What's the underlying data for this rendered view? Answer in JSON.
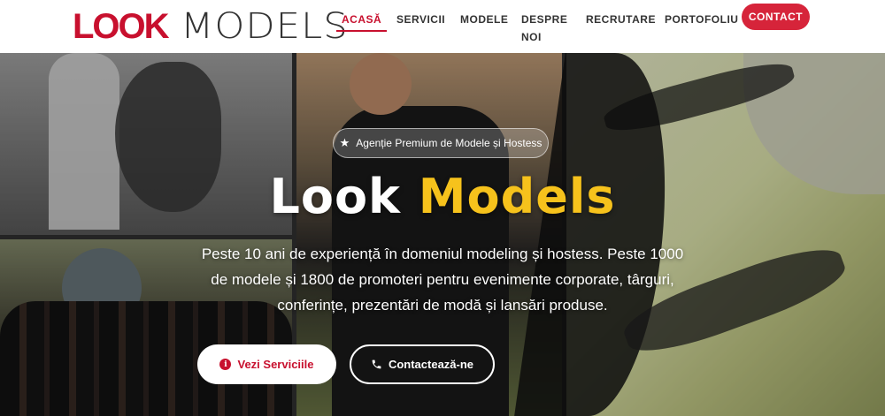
{
  "brand": {
    "look": "LOOK",
    "models": "MODELS"
  },
  "nav": {
    "items": [
      {
        "label": "ACASĂ",
        "active": true
      },
      {
        "label": "SERVICII"
      },
      {
        "label": "MODELE"
      },
      {
        "label": "DESPRE NOI"
      },
      {
        "label": "RECRUTARE"
      },
      {
        "label": "PORTOFOLIU"
      }
    ],
    "contact_label": "CONTACT"
  },
  "hero": {
    "badge": "Agenție Premium de Modele și Hostess",
    "badge_icon": "star-icon",
    "title_part1": "Look",
    "title_part2": "Models",
    "description": "Peste 10 ani de experiență în domeniul modeling și hostess. Peste 1000 de modele și 1800 de promoteri pentru evenimente corporate, târguri, conferințe, prezentări de modă și lansări produse.",
    "primary_button": "Vezi Serviciile",
    "primary_icon": "info-icon",
    "secondary_button": "Contactează-ne",
    "secondary_icon": "phone-icon"
  },
  "colors": {
    "brand_red": "#c8102e",
    "accent_yellow": "#f6c21c"
  }
}
